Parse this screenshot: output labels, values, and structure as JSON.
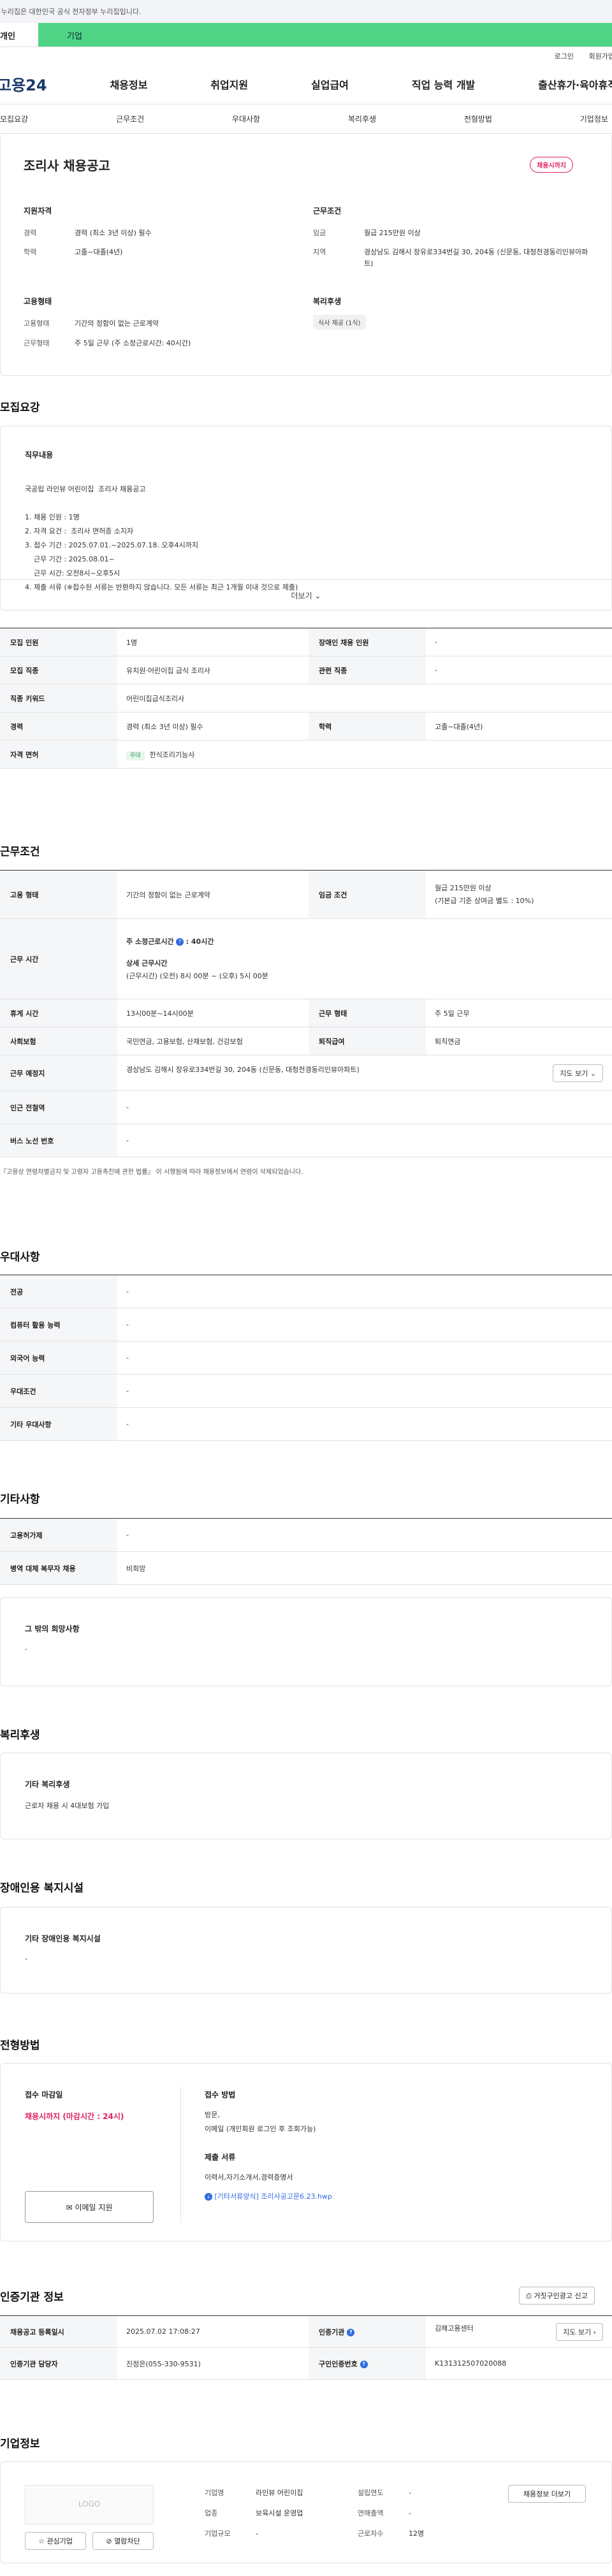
{
  "gov_banner": "이 누리집은 대한민국 공식 전자정부 누리집입니다.",
  "top_tabs": [
    "개인",
    "기업"
  ],
  "util_links": [
    "로그인",
    "회원가입"
  ],
  "logo": "고용24",
  "gnb": [
    "채용정보",
    "취업지원",
    "실업급여",
    "직업 능력 개발",
    "출산휴가·육아휴직"
  ],
  "subnav": [
    "모집요강",
    "근무조건",
    "우대사항",
    "복리후생",
    "전형방법",
    "기업정보"
  ],
  "job": {
    "title": "조리사 채용공고",
    "status": "채용시까지"
  },
  "summary": {
    "qual_title": "지원자격",
    "cond_title": "근무조건",
    "emp_title": "고용형태",
    "welfare_title": "복리후생",
    "career_k": "경력",
    "career_v": "경력 (최소 3년 이상) 필수",
    "edu_k": "학력",
    "edu_v": "고졸~대졸(4년)",
    "wage_k": "임금",
    "wage_v": "월급 215만원 이상",
    "area_k": "지역",
    "area_v": "경상남도 김해시 장유로334번길 30, 204동 (신문동, 대청천경동리인뷰아파트)",
    "emptype_k": "고용형태",
    "emptype_v": "기간의 정함이 없는 근로계약",
    "worktype_k": "근무형태",
    "worktype_v": "주 5일 근무 (주 소정근로시간: 40시간)",
    "welfare_chip": "식사 제공 (1식)"
  },
  "recruit": {
    "title": "모집요강",
    "duty_title": "직무내용",
    "duty_lines": [
      "국공립 라인뷰 어린이집  조리사 채용공고",
      "",
      "1. 채용 인원 : 1명",
      "2. 자격 요건 :  조리사 면허증 소지자",
      "3. 접수 기간 : 2025.07.01.~2025.07.18. 오후4시까지",
      "    근무 기간 : 2025.08.01~",
      "    근무 시간: 오전8시~오후5시",
      "4. 제출 서류 (※접수된 서류는 반환하지 않습니다. 모든 서류는 최근 1개월 이내 것으로 제출)"
    ],
    "more": "더보기",
    "rows": [
      {
        "k1": "모집 인원",
        "v1": "1명",
        "k2": "장애인 채용 인원",
        "v2": "-"
      },
      {
        "k1": "모집 직종",
        "v1": "유치원·어린이집 급식 조리사",
        "k2": "관련 직종",
        "v2": "-"
      },
      {
        "k1": "직종 키워드",
        "v1": "어린이집급식조리사"
      },
      {
        "k1": "경력",
        "v1": "경력 (최소 3년 이상) 필수",
        "k2": "학력",
        "v2": "고졸~대졸(4년)"
      },
      {
        "k1": "자격 면허",
        "chip": "우대",
        "v1": "한식조리기능사"
      }
    ]
  },
  "work": {
    "title": "근무조건",
    "emp_k": "고용 형태",
    "emp_v": "기간의 정함이 없는 근로계약",
    "wage_k": "임금 조건",
    "wage_v1": "월급 215만원 이상",
    "wage_v2": "(기본급 기준 상여금 별도 : 10%)",
    "time_k": "근무 시간",
    "time_h1": "주 소정근로시간",
    "time_h1v": ": 40시간",
    "time_h2": "상세 근무시간",
    "time_v2": "(근무시간) (오전) 8시 00분 ~ (오후) 5시 00분",
    "rest_k": "휴게 시간",
    "rest_v": "13시00분~14시00분",
    "form_k": "근무 형태",
    "form_v": "주 5일 근무",
    "ins_k": "사회보험",
    "ins_v": "국민연금, 고용보험, 산재보험, 건강보험",
    "ret_k": "퇴직급여",
    "ret_v": "퇴직연금",
    "loc_k": "근무 예정지",
    "loc_v": "경상남도 김해시 장유로334번길 30, 204동 (신문동, 대청천경동리인뷰아파트)",
    "map_btn": "지도 보기",
    "sub_k": "인근 전철역",
    "sub_v": "-",
    "bus_k": "버스 노선 번호",
    "bus_v": "-",
    "note": "『고용상 연령차별금지 및 고령자 고용촉진에 관한 법률』 이 시행됨에 따라 채용정보에서 연령이 삭제되었습니다."
  },
  "pref": {
    "title": "우대사항",
    "rows": [
      [
        "전공",
        "-"
      ],
      [
        "컴퓨터 활용 능력",
        "-"
      ],
      [
        "외국어 능력",
        "-"
      ],
      [
        "우대조건",
        "-"
      ],
      [
        "기타 우대사항",
        "-"
      ]
    ]
  },
  "etc": {
    "title": "기타사항",
    "rows": [
      [
        "고용허가제",
        "-"
      ],
      [
        "병역 대체 복무자 채용",
        "비희망"
      ]
    ],
    "hope_title": "그 밖의 희망사항",
    "hope_v": "-"
  },
  "welfare": {
    "title": "복리후생",
    "sub": "기타 복리후생",
    "v": "근로자 채용 시 4대보험 가입"
  },
  "disab": {
    "title": "장애인용 복지시설",
    "sub": "기타 장애인용 복지시설",
    "v": "-"
  },
  "select": {
    "title": "전형방법",
    "dl_title": "접수 마감일",
    "dl_v": "채용시까지 (마감시간 : 24시)",
    "email_btn": "이메일 지원",
    "method_title": "접수 방법",
    "method_v1": "방문,",
    "method_v2": "이메일 (개인회원 로그인 후 조회가능)",
    "docs_title": "제출 서류",
    "docs_v": "이력서,자기소개서,경력증명서",
    "file": "[기타서류양식] 조리사공고문6.23.hwp"
  },
  "cert": {
    "title": "인증기관 정보",
    "report_btn": "거짓구인광고 신고",
    "reg_k": "채용공고 등록일시",
    "reg_v": "2025.07.02 17:08:27",
    "org_k": "인증기관",
    "org_v": "김해고용센터",
    "map_btn": "지도 보기",
    "mgr_k": "인증기관 담당자",
    "mgr_v": "진정은(055-330-9531)",
    "no_k": "구인인증번호",
    "no_v": "K131312507020088"
  },
  "company": {
    "title": "기업정보",
    "logo": "LOGO",
    "fav_btn": "관심기업",
    "block_btn": "열람차단",
    "name_k": "기업명",
    "name_v": "라인뷰 어린이집",
    "ind_k": "업종",
    "ind_v": "보육시설 운영업",
    "size_k": "기업규모",
    "size_v": "-",
    "year_k": "설립연도",
    "year_v": "-",
    "sales_k": "연매출액",
    "sales_v": "-",
    "emp_k": "근로자수",
    "emp_v": "12명",
    "more_btn": "채용정보 더보기"
  }
}
